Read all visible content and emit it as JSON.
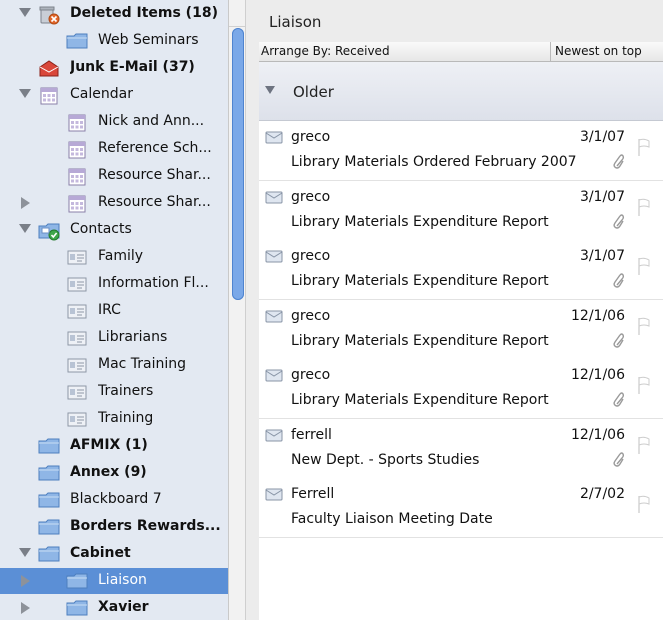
{
  "sidebar": {
    "items": [
      {
        "label": "Deleted Items (18)",
        "bold": true,
        "expand": "down",
        "icon": "trash-icon",
        "indent": 0
      },
      {
        "label": "Web Seminars",
        "bold": false,
        "expand": "none",
        "icon": "folder-icon",
        "indent": 1
      },
      {
        "label": "Junk E-Mail (37)",
        "bold": true,
        "expand": "none",
        "icon": "junk-mail-icon",
        "indent": 0
      },
      {
        "label": "Calendar",
        "bold": false,
        "expand": "down",
        "icon": "calendar-icon",
        "indent": 0
      },
      {
        "label": "Nick and Ann...",
        "bold": false,
        "expand": "none",
        "icon": "calendar-icon",
        "indent": 1
      },
      {
        "label": "Reference Sch...",
        "bold": false,
        "expand": "none",
        "icon": "calendar-icon",
        "indent": 1
      },
      {
        "label": "Resource Shar...",
        "bold": false,
        "expand": "none",
        "icon": "calendar-icon",
        "indent": 1
      },
      {
        "label": "Resource Shar...",
        "bold": false,
        "expand": "right",
        "icon": "calendar-icon",
        "indent": 1
      },
      {
        "label": "Contacts",
        "bold": false,
        "expand": "down",
        "icon": "contacts-icon",
        "indent": 0
      },
      {
        "label": "Family",
        "bold": false,
        "expand": "none",
        "icon": "contact-card-icon",
        "indent": 1
      },
      {
        "label": "Information Fl...",
        "bold": false,
        "expand": "none",
        "icon": "contact-card-icon",
        "indent": 1
      },
      {
        "label": "IRC",
        "bold": false,
        "expand": "none",
        "icon": "contact-card-icon",
        "indent": 1
      },
      {
        "label": "Librarians",
        "bold": false,
        "expand": "none",
        "icon": "contact-card-icon",
        "indent": 1
      },
      {
        "label": "Mac Training",
        "bold": false,
        "expand": "none",
        "icon": "contact-card-icon",
        "indent": 1
      },
      {
        "label": "Trainers",
        "bold": false,
        "expand": "none",
        "icon": "contact-card-icon",
        "indent": 1
      },
      {
        "label": "Training",
        "bold": false,
        "expand": "none",
        "icon": "contact-card-icon",
        "indent": 1
      },
      {
        "label": "AFMIX (1)",
        "bold": true,
        "expand": "none",
        "icon": "folder-icon",
        "indent": 0
      },
      {
        "label": "Annex (9)",
        "bold": true,
        "expand": "none",
        "icon": "folder-icon",
        "indent": 0
      },
      {
        "label": "Blackboard 7",
        "bold": false,
        "expand": "none",
        "icon": "folder-icon",
        "indent": 0
      },
      {
        "label": "Borders Rewards...",
        "bold": true,
        "expand": "none",
        "icon": "folder-icon",
        "indent": 0
      },
      {
        "label": "Cabinet",
        "bold": true,
        "expand": "down",
        "icon": "folder-icon",
        "indent": 0
      },
      {
        "label": "Liaison",
        "bold": false,
        "expand": "right",
        "icon": "folder-icon",
        "indent": 1,
        "selected": true
      },
      {
        "label": "Xavier",
        "bold": true,
        "expand": "right",
        "icon": "folder-icon",
        "indent": 1
      }
    ]
  },
  "pane": {
    "title": "Liaison",
    "arrange_by": "Arrange By: Received",
    "sort_order": "Newest on top",
    "group_label": "Older"
  },
  "messages": [
    {
      "from": "greco",
      "date": "3/1/07",
      "subject": "Library Materials Ordered February 2007",
      "attachment": true
    },
    {
      "from": "greco",
      "date": "3/1/07",
      "subject": "Library Materials Expenditure Report",
      "attachment": true
    },
    {
      "from": "greco",
      "date": "3/1/07",
      "subject": "Library Materials Expenditure Report",
      "attachment": true
    },
    {
      "from": "greco",
      "date": "12/1/06",
      "subject": "Library Materials Expenditure Report",
      "attachment": true
    },
    {
      "from": "greco",
      "date": "12/1/06",
      "subject": "Library Materials Expenditure Report",
      "attachment": true
    },
    {
      "from": "ferrell",
      "date": "12/1/06",
      "subject": "New Dept. - Sports Studies",
      "attachment": true
    },
    {
      "from": "Ferrell",
      "date": "2/7/02",
      "subject": "Faculty Liaison Meeting Date",
      "attachment": false
    }
  ],
  "colors": {
    "sidebar_bg": "#e3e9f2",
    "selection": "#5b8fd6",
    "folder_blue": "#8fb6e6"
  }
}
